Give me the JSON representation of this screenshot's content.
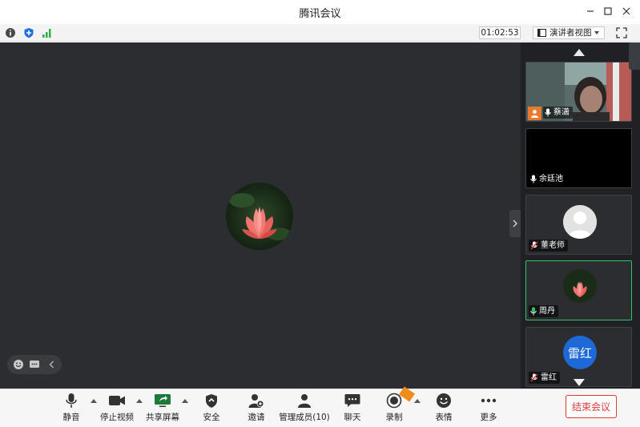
{
  "window": {
    "title": "腾讯会议"
  },
  "infobar": {
    "timer": "01:02:53",
    "view_mode": "演讲者视图"
  },
  "participants": [
    {
      "name": "蔡潇"
    },
    {
      "name": "余廷池"
    },
    {
      "name": "董老师"
    },
    {
      "name": "周丹"
    },
    {
      "name": "雷红",
      "avatar_text": "雷红"
    }
  ],
  "toolbar": {
    "mute": "静音",
    "stop_video": "停止视频",
    "share_screen": "共享屏幕",
    "security": "安全",
    "invite": "邀请",
    "manage_members": "管理成员(10)",
    "chat": "聊天",
    "record": "录制",
    "reactions": "表情",
    "more": "更多",
    "end_meeting": "结束会议"
  },
  "colors": {
    "main_bg": "#2b2d31",
    "panel_bg": "#202124",
    "active_border": "#35c06a",
    "end_red": "#e23838",
    "avatar_blue": "#1e68d8"
  },
  "icons": [
    "info-icon",
    "shield-icon",
    "signal-icon",
    "layout-icon",
    "fullscreen-icon",
    "mic-icon",
    "camera-icon",
    "share-icon",
    "lock-shield-icon",
    "add-user-icon",
    "members-icon",
    "chat-icon",
    "record-icon",
    "emoji-icon",
    "more-icon"
  ]
}
